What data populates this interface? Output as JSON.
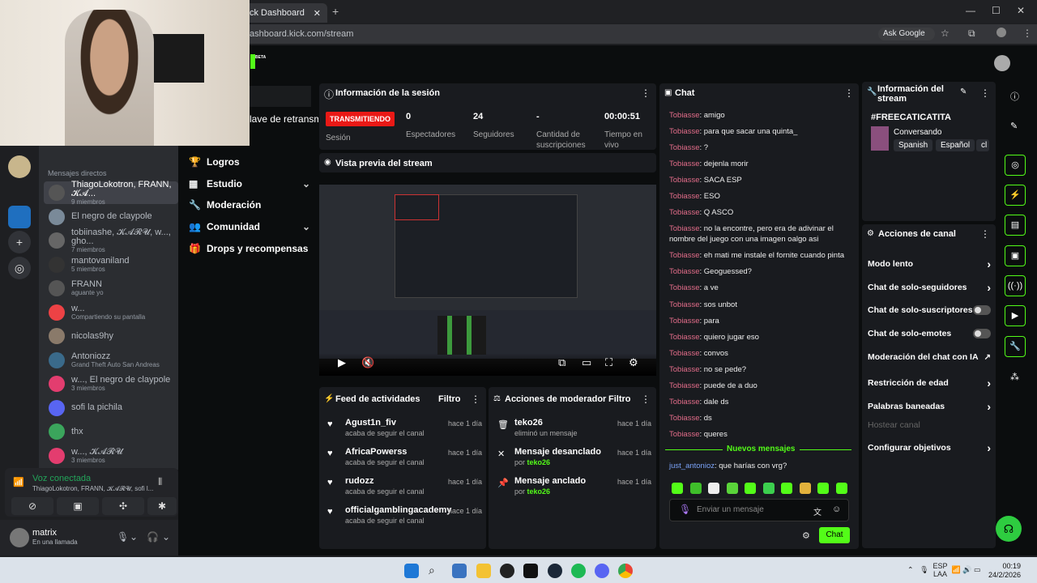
{
  "browser": {
    "tab_title": "ck Dashboard",
    "url": "ashboard.kick.com/stream",
    "ask_google": "Ask Google"
  },
  "kick": {
    "beta": "BETA",
    "nav_truncated": "lave de retransm",
    "nav": [
      {
        "label": "Logros",
        "icon": "trophy-icon",
        "chevron": false
      },
      {
        "label": "Estudio",
        "icon": "studio-icon",
        "chevron": true
      },
      {
        "label": "Moderación",
        "icon": "wrench-icon",
        "chevron": false
      },
      {
        "label": "Comunidad",
        "icon": "community-icon",
        "chevron": true
      },
      {
        "label": "Drops y recompensas",
        "icon": "gift-icon",
        "chevron": false
      }
    ],
    "session": {
      "title": "Información de la sesión",
      "live": "TRANSMITIENDO",
      "session_label": "Sesión",
      "stats": [
        {
          "value": "0",
          "label": "Espectadores"
        },
        {
          "value": "24",
          "label": "Seguidores"
        },
        {
          "value": "-",
          "label": "Cantidad de suscripciones"
        },
        {
          "value": "00:00:51",
          "label": "Tiempo en vivo"
        }
      ]
    },
    "preview_title": "Vista previa del stream",
    "feed": {
      "title": "Feed de actividades",
      "filter": "Filtro",
      "items": [
        {
          "name": "Agust1n_fiv",
          "sub": "acaba de seguir el canal",
          "time": "hace 1 día"
        },
        {
          "name": "AfricaPowerss",
          "sub": "acaba de seguir el canal",
          "time": "hace 1 día"
        },
        {
          "name": "rudozz",
          "sub": "acaba de seguir el canal",
          "time": "hace 1 día"
        },
        {
          "name": "officialgamblingacademy",
          "sub": "acaba de seguir el canal",
          "time": "hace 1 día"
        }
      ]
    },
    "mod": {
      "title": "Acciones de moderador",
      "filter": "Filtro",
      "items": [
        {
          "name": "teko26",
          "sub": "eliminó un mensaje",
          "by": "",
          "time": "hace 1 día"
        },
        {
          "name": "Mensaje desanclado",
          "sub": "por",
          "by": "teko26",
          "time": "hace 1 día"
        },
        {
          "name": "Mensaje anclado",
          "sub": "por",
          "by": "teko26",
          "time": "hace 1 día"
        }
      ]
    },
    "chat": {
      "title": "Chat",
      "messages": [
        {
          "user": "Tobiasse",
          "text": ": amigo"
        },
        {
          "user": "Tobiasse",
          "text": ": para que sacar una quinta_"
        },
        {
          "user": "Tobiasse",
          "text": ": ?"
        },
        {
          "user": "Tobiasse",
          "text": ": dejenla morir"
        },
        {
          "user": "Tobiasse",
          "text": ": SACA ESP"
        },
        {
          "user": "Tobiasse",
          "text": ": ESO"
        },
        {
          "user": "Tobiasse",
          "text": ": Q ASCO"
        },
        {
          "user": "Tobiasse",
          "text": ": no la encontre, pero era de adivinar el nombre del juego con una imagen oalgo asi"
        },
        {
          "user": "Tobiasse",
          "text": ": eh mati me instale el fornite cuando pinta"
        },
        {
          "user": "Tobiasse",
          "text": ": Geoguessed?"
        },
        {
          "user": "Tobiasse",
          "text": ": a ve"
        },
        {
          "user": "Tobiasse",
          "text": ": sos unbot"
        },
        {
          "user": "Tobiasse",
          "text": ": para"
        },
        {
          "user": "Tobiasse",
          "text": ": quiero jugar eso"
        },
        {
          "user": "Tobiasse",
          "text": ": convos"
        },
        {
          "user": "Tobiasse",
          "text": ": no se pede?"
        },
        {
          "user": "Tobiasse",
          "text": ": puede de a duo"
        },
        {
          "user": "Tobiasse",
          "text": ": dale ds"
        },
        {
          "user": "Tobiasse",
          "text": ": ds"
        },
        {
          "user": "Tobiasse",
          "text": ": queres"
        }
      ],
      "new_messages": "Nuevos mensajes",
      "last": {
        "user": "just_antonioz",
        "text": ": que harías con vrg?"
      },
      "placeholder": "Enviar un mensaje",
      "send": "Chat"
    },
    "info": {
      "title": "Información del stream",
      "stream_title": "#FREECATICATITA",
      "category": "Conversando",
      "tags": [
        "Spanish",
        "Español",
        "cl"
      ]
    },
    "actions": {
      "title": "Acciones de canal",
      "items": [
        {
          "label": "Modo lento",
          "kind": "chevron"
        },
        {
          "label": "Chat de solo-seguidores",
          "kind": "chevron"
        },
        {
          "label": "Chat de solo-suscriptores",
          "kind": "toggle"
        },
        {
          "label": "Chat de solo-emotes",
          "kind": "toggle"
        },
        {
          "label": "Moderación del chat con IA",
          "kind": "external"
        },
        {
          "label": "Restricción de edad",
          "kind": "chevron"
        },
        {
          "label": "Palabras baneadas",
          "kind": "chevron"
        },
        {
          "label": "Hostear canal",
          "kind": "disabled"
        },
        {
          "label": "Configurar objetivos",
          "kind": "chevron"
        }
      ]
    }
  },
  "discord": {
    "dm_title": "Mensajes directos",
    "dms": [
      {
        "name": "ThiagoLokotron, FRANN, 𝓚𝓐...",
        "sub": "9 miembros"
      },
      {
        "name": "El negro de claypole",
        "sub": ""
      },
      {
        "name": "tobiinashe, 𝓚𝓐𝓡𝓤, w..., gho...",
        "sub": "7 miembros"
      },
      {
        "name": "mantovaniland",
        "sub": "5 miembros"
      },
      {
        "name": "FRANN",
        "sub": "aguante yo"
      },
      {
        "name": "w...",
        "sub": "Compartiendo su pantalla"
      },
      {
        "name": "nicolas9hy",
        "sub": ""
      },
      {
        "name": "Antoniozz",
        "sub": "Grand Theft Auto San Andreas"
      },
      {
        "name": "w..., El negro de claypole",
        "sub": "3 miembros"
      },
      {
        "name": "sofi la pichila",
        "sub": ""
      },
      {
        "name": "thx",
        "sub": ""
      },
      {
        "name": "w..., 𝓚𝓐𝓡𝓤",
        "sub": "3 miembros"
      }
    ],
    "voice_title": "Voz conectada",
    "voice_sub": "ThiagoLokotron, FRANN, 𝓚𝓐𝓡𝓤, sofi l...",
    "user_name": "matrix",
    "user_status": "En una llamada"
  },
  "taskbar": {
    "lang1": "ESP",
    "lang2": "LAA",
    "time": "00:19",
    "date": "24/2/2026"
  },
  "colors": {
    "kick_green": "#53fc18",
    "live_red": "#e91916",
    "chat_user": "#e36d8a"
  }
}
